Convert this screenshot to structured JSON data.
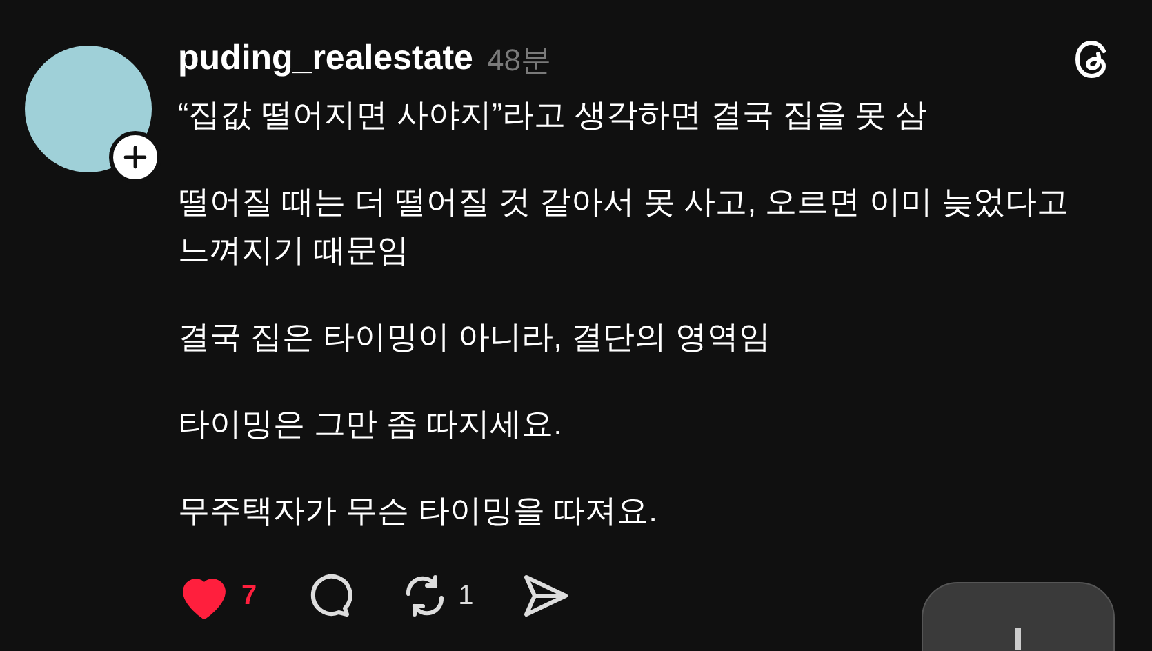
{
  "post": {
    "username": "puding_realestate",
    "time": "48분",
    "liked": true,
    "paragraphs": [
      "“집값 떨어지면 사야지”라고 생각하면 결국 집을 못 삼",
      "떨어질 때는 더 떨어질 것 같아서 못 사고, 오르면 이미 늦었다고 느껴지기 때문임",
      "결국 집은 타이밍이 아니라, 결단의 영역임",
      "타이밍은 그만 좀 따지세요.",
      "무주택자가 무슨 타이밍을 따져요."
    ],
    "like_count": "7",
    "repost_count": "1"
  }
}
